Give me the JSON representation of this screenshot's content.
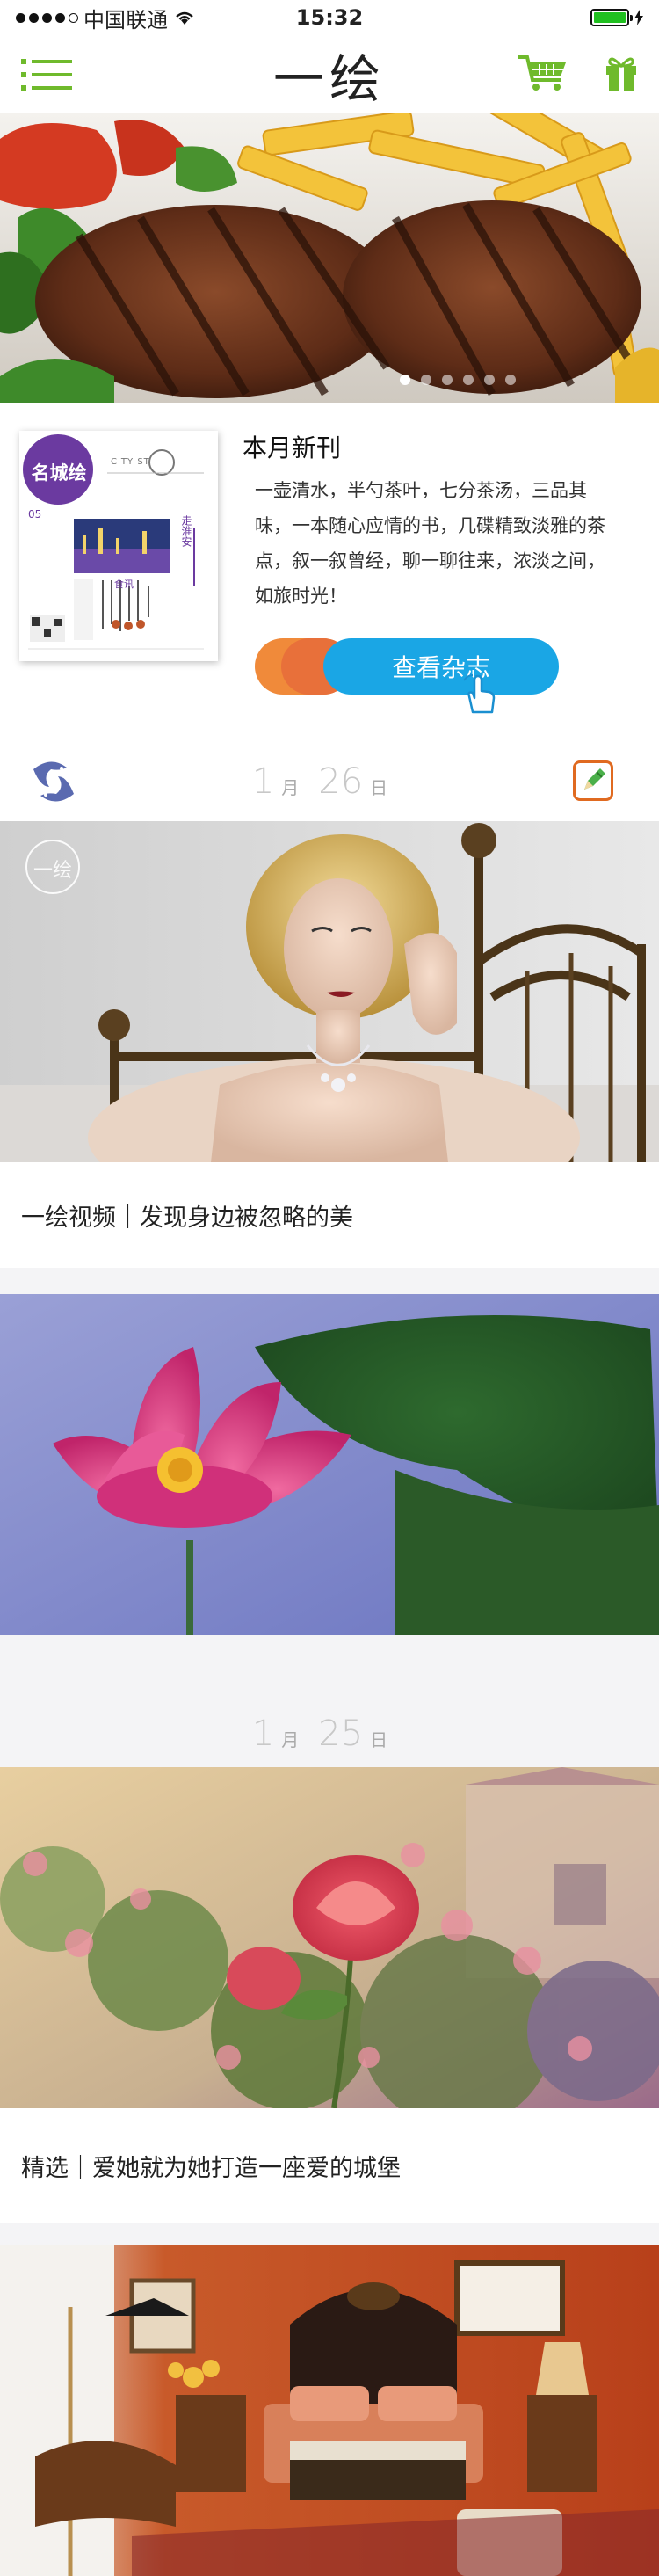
{
  "status_bar": {
    "carrier": "中国联通",
    "time": "15:32"
  },
  "nav": {
    "title": "一绘",
    "icons": [
      "menu-icon",
      "cart-icon",
      "gift-icon"
    ]
  },
  "hero": {
    "pages": 6,
    "active_page": 0
  },
  "magazine": {
    "section_title": "本月新刊",
    "description": "一壶清水，半勺茶叶，七分茶汤，三品其味，一本随心应情的书，几碟精致淡雅的茶点，叙一叙曾经，聊一聊往来，浓淡之间，如旅时光！",
    "button_label": "查看杂志",
    "cover": {
      "badge": "名城绘",
      "header_line": "CITY ST",
      "issue": "05",
      "side_text_1": "走淮安",
      "side_text_2": "食讯"
    }
  },
  "feed": [
    {
      "date_month": "1",
      "date_month_unit": "月",
      "date_day": "26",
      "date_day_unit": "日"
    },
    {
      "caption": "一绘视频｜发现身边被忽略的美",
      "watermark": "一绘"
    },
    {
      "date_month": "1",
      "date_month_unit": "月",
      "date_day": "25",
      "date_day_unit": "日"
    },
    {
      "caption": "精选｜爱她就为她打造一座爱的城堡"
    }
  ],
  "colors": {
    "accent_green": "#6fba2c",
    "button_blue": "#1aa6e5",
    "button_orange": "#f08a3a",
    "cover_purple": "#6b3aa0"
  }
}
